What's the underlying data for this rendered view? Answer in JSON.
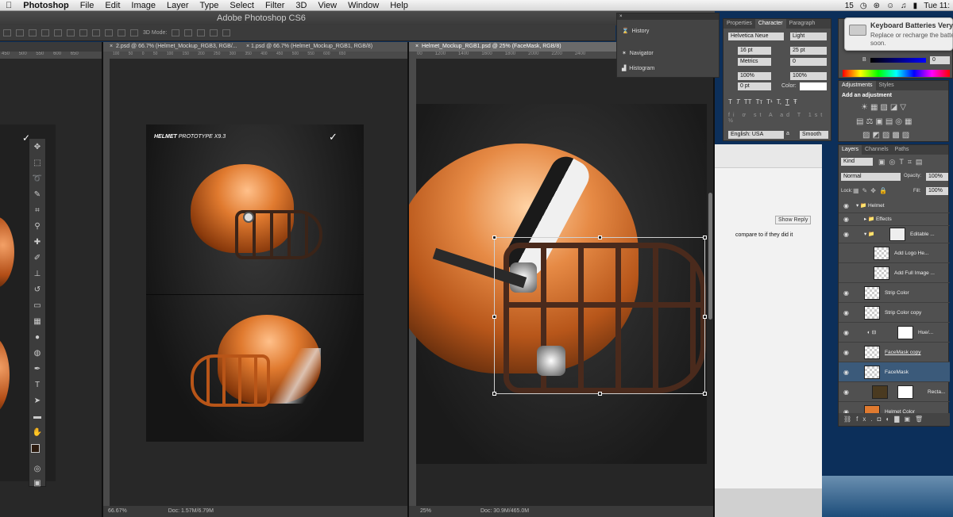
{
  "menubar": {
    "apple": "",
    "app": "Photoshop",
    "items": [
      "File",
      "Edit",
      "Image",
      "Layer",
      "Type",
      "Select",
      "Filter",
      "3D",
      "View",
      "Window",
      "Help"
    ],
    "status_num": "15",
    "clock": "Tue 11:"
  },
  "app_title": "Adobe Photoshop CS6",
  "options": {
    "mode_label": "3D Mode:"
  },
  "doc1": {
    "tab": "2.psd @ 66.7% (Helmet_Mockup_RGB3, RGB/...",
    "zoom": "66.67%",
    "docsize": "Doc: 1.57M/6.79M",
    "ruler": [
      "450",
      "500",
      "550",
      "600",
      "650"
    ]
  },
  "doc2": {
    "tab": "1.psd @ 66.7% (Helmet_Mockup_RGB1, RGB/8)",
    "ruler": [
      "100",
      "50",
      "0",
      "50",
      "100",
      "150",
      "200",
      "250",
      "300",
      "350",
      "400",
      "450",
      "500",
      "550",
      "600",
      "650"
    ],
    "poster_title_bold": "HELMET",
    "poster_title_rest": "PROTOTYPE X9.3",
    "zoom": "66.67%",
    "docsize": "Doc: 1.57M/6.79M"
  },
  "doc3": {
    "tab": "Helmet_Mockup_RGB1.psd @ 25% (FaceMask, RGB/8)",
    "ruler": [
      "00",
      "1200",
      "1400",
      "1600",
      "1800",
      "2000",
      "2200",
      "2400"
    ],
    "vruler": [
      "200",
      "0",
      "200",
      "400",
      "600",
      "800",
      "1000",
      "1200",
      "1400",
      "1600",
      "1800",
      "2000",
      "2200",
      "2400",
      "2600"
    ],
    "zoom": "25%",
    "docsize": "Doc: 30.9M/465.0M"
  },
  "history_panel": {
    "items": [
      "History",
      "Navigator",
      "Histogram"
    ]
  },
  "character_panel": {
    "tabs": [
      "Properties",
      "Character",
      "Paragraph"
    ],
    "font_family": "Helvetica Neue",
    "font_style": "Light",
    "size": "16 pt",
    "leading": "25 pt",
    "kerning": "Metrics",
    "tracking": "0",
    "vscale": "100%",
    "hscale": "100%",
    "baseline": "0 pt",
    "color_label": "Color:",
    "type_buttons": [
      "T",
      "T",
      "TT",
      "Tт",
      "T¹",
      "T,",
      "T",
      "Ŧ"
    ],
    "language": "English: USA",
    "aa_label": "a",
    "aa": "Smooth"
  },
  "color_panel": {
    "channel": "B",
    "value": "0"
  },
  "adjustments_panel": {
    "tabs": [
      "Adjustments",
      "Styles"
    ],
    "heading": "Add an adjustment"
  },
  "layers_panel": {
    "tabs": [
      "Layers",
      "Channels",
      "Paths"
    ],
    "kind": "Kind",
    "blend": "Normal",
    "opacity_label": "Opacity:",
    "opacity": "100%",
    "lock_label": "Lock:",
    "fill_label": "Fill:",
    "fill": "100%",
    "layers": [
      {
        "name": "Helmet"
      },
      {
        "name": "Effects"
      },
      {
        "name": "Editable ..."
      },
      {
        "name": "Add Logo He..."
      },
      {
        "name": "Add Full Image ..."
      },
      {
        "name": "Strip Color"
      },
      {
        "name": "Strip Color copy"
      },
      {
        "name": "Hue/..."
      },
      {
        "name": "FaceMask copy"
      },
      {
        "name": "FaceMask"
      },
      {
        "name": "Recta..."
      },
      {
        "name": "Helmet Color"
      }
    ],
    "fx": "fx."
  },
  "background_page": {
    "show_reply": "Show Reply",
    "comment": "compare to if they did it"
  },
  "notification": {
    "title": "Keyboard Batteries Very",
    "body1": "Replace or recharge the batte",
    "body2": "soon."
  },
  "colors": {
    "helmet_orange": "#d4692b",
    "facemask_brown": "#4a2a1c",
    "selection": "#3b5a7a"
  }
}
